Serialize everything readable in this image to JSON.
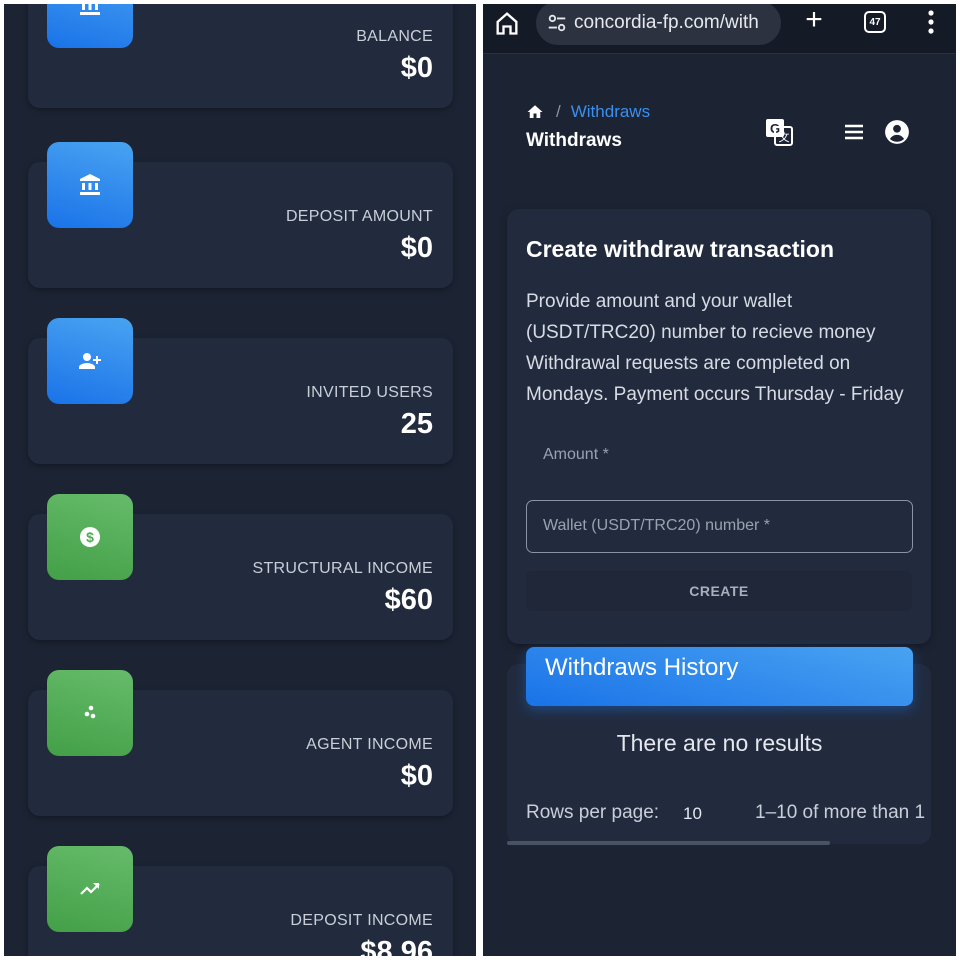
{
  "colors": {
    "background": "#1c2434",
    "card": "#222b3e",
    "blue_icon": "#1a73e8",
    "green_icon": "#4caf50",
    "link": "#3b8ff0"
  },
  "left": {
    "stats": [
      {
        "label": "BALANCE",
        "value": "$0",
        "icon": "bank-icon",
        "color": "blue"
      },
      {
        "label": "DEPOSIT AMOUNT",
        "value": "$0",
        "icon": "bank-icon",
        "color": "blue"
      },
      {
        "label": "INVITED USERS",
        "value": "25",
        "icon": "person-add-icon",
        "color": "blue"
      },
      {
        "label": "STRUCTURAL INCOME",
        "value": "$60",
        "icon": "dollar-circle-icon",
        "color": "green"
      },
      {
        "label": "AGENT INCOME",
        "value": "$0",
        "icon": "dots-icon",
        "color": "green"
      },
      {
        "label": "DEPOSIT INCOME",
        "value": "$8.96",
        "icon": "trending-up-icon",
        "color": "green"
      }
    ]
  },
  "browser": {
    "url": "concordia-fp.com/with",
    "tab_count": "47"
  },
  "header": {
    "breadcrumb_link": "Withdraws",
    "title": "Withdraws"
  },
  "form": {
    "title": "Create withdraw transaction",
    "description_lines": [
      "Provide amount and your wallet",
      "(USDT/TRC20) number to recieve money",
      "Withdrawal requests are completed on",
      "Mondays. Payment occurs Thursday - Friday"
    ],
    "amount_label": "Amount *",
    "wallet_label": "Wallet (USDT/TRC20) number *",
    "create_button": "CREATE"
  },
  "history": {
    "title": "Withdraws History",
    "empty_text": "There are no results",
    "rows_per_page_label": "Rows per page:",
    "rows_per_page_value": "10",
    "pagination_text": "1–10 of more than 1"
  }
}
